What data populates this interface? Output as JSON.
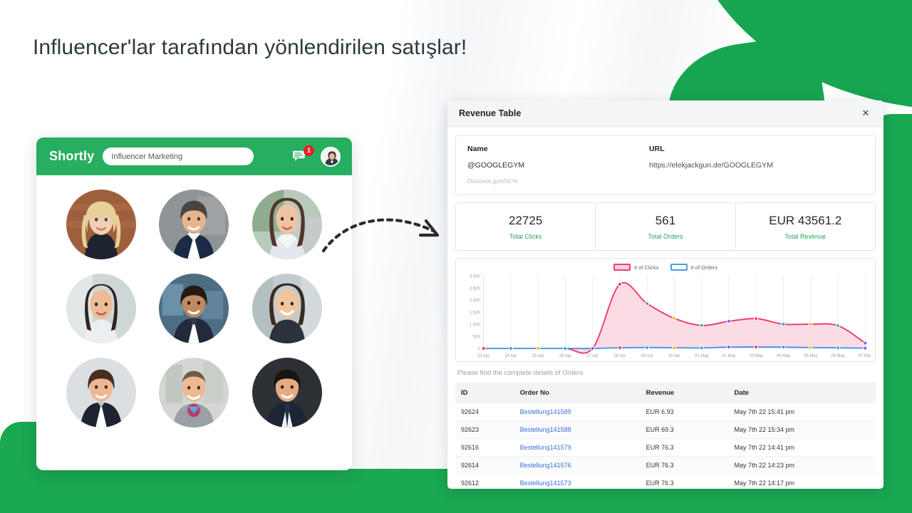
{
  "headline": "Influencer'lar tarafından yönlendirilen satışlar!",
  "theme": {
    "green": "#1AA851",
    "header_green": "#27AE60",
    "accent_pink": "#EE3E6D",
    "accent_blue": "#4E9BE8",
    "link_blue": "#3B6FD4",
    "badge_red": "#E8212B"
  },
  "left_app": {
    "logo": "Shortly",
    "search_value": "Influencer Marketing",
    "search_placeholder": "Influencer Marketing",
    "notification_count": "1",
    "chat_icon": "chat-bubble-icon",
    "avatar_icon": "user-avatar-icon",
    "influencers": [
      {
        "label": "influencer-1"
      },
      {
        "label": "influencer-2"
      },
      {
        "label": "influencer-3"
      },
      {
        "label": "influencer-4"
      },
      {
        "label": "influencer-5"
      },
      {
        "label": "influencer-6"
      },
      {
        "label": "influencer-7"
      },
      {
        "label": "influencer-8"
      },
      {
        "label": "influencer-9"
      }
    ]
  },
  "arrow": {
    "icon": "dashed-curved-arrow-icon"
  },
  "panel": {
    "title": "Revenue Table",
    "close_icon": "close-icon",
    "info": {
      "name_label": "Name",
      "name_value": "@GOOGLEGYM",
      "discount": "Discount gym50 %",
      "url_label": "URL",
      "url_value": "https://elekjackgun.de/GOOGLEGYM"
    },
    "stats": [
      {
        "value": "22725",
        "label": "Total Clicks"
      },
      {
        "value": "561",
        "label": "Total Orders"
      },
      {
        "value": "EUR 43561.2",
        "label": "Total Revenue"
      }
    ],
    "note": "Please find the complete details of Orders",
    "table": {
      "columns": [
        "ID",
        "Order No",
        "Revenue",
        "Date"
      ],
      "rows": [
        {
          "id": "92624",
          "order_no": "Bestellung141589",
          "revenue": "EUR 6.93",
          "date": "May 7th 22 15:41 pm"
        },
        {
          "id": "92623",
          "order_no": "Bestellung141588",
          "revenue": "EUR 69.3",
          "date": "May 7th 22 15:34 pm"
        },
        {
          "id": "92616",
          "order_no": "Bestellung141579",
          "revenue": "EUR 76.3",
          "date": "May 7th 22 14:41 pm"
        },
        {
          "id": "92614",
          "order_no": "Bestellung141576",
          "revenue": "EUR 76.3",
          "date": "May 7th 22 14:23 pm"
        },
        {
          "id": "92612",
          "order_no": "Bestellung141573",
          "revenue": "EUR 76.3",
          "date": "May 7th 22 14:17 pm"
        }
      ]
    }
  },
  "chart_data": {
    "type": "area",
    "title": "",
    "xlabel": "",
    "ylabel": "",
    "ylim": [
      0,
      3000
    ],
    "yticks": [
      0,
      500,
      1000,
      1500,
      2000,
      2500,
      3000
    ],
    "ytick_labels": [
      "0",
      "500",
      "1,000",
      "1,500",
      "2,000",
      "2,500",
      "3,000"
    ],
    "grid": true,
    "legend_position": "top-center",
    "categories": [
      "23 Apr",
      "24 Apr",
      "25 Apr",
      "26 Apr",
      "27 Apr",
      "28 Apr",
      "29 Apr",
      "30 Apr",
      "01 May",
      "02 May",
      "03 May",
      "04 May",
      "05 May",
      "06 May",
      "07 May"
    ],
    "series": [
      {
        "name": "# of Clicks",
        "color": "#EE3E6D",
        "fill": "#FBD6DF",
        "values": [
          0,
          0,
          0,
          0,
          0,
          2650,
          1850,
          1240,
          950,
          1120,
          1230,
          1000,
          1000,
          940,
          220
        ]
      },
      {
        "name": "# of Orders",
        "color": "#4E9BE8",
        "fill": "none",
        "values": [
          0,
          0,
          0,
          0,
          0,
          30,
          35,
          30,
          20,
          55,
          60,
          55,
          35,
          25,
          10
        ]
      }
    ],
    "marker_colors": [
      "#EE3E6D",
      "#4E9BE8",
      "#F7B733",
      "#2CB9A8",
      "#8A5CF0"
    ]
  }
}
